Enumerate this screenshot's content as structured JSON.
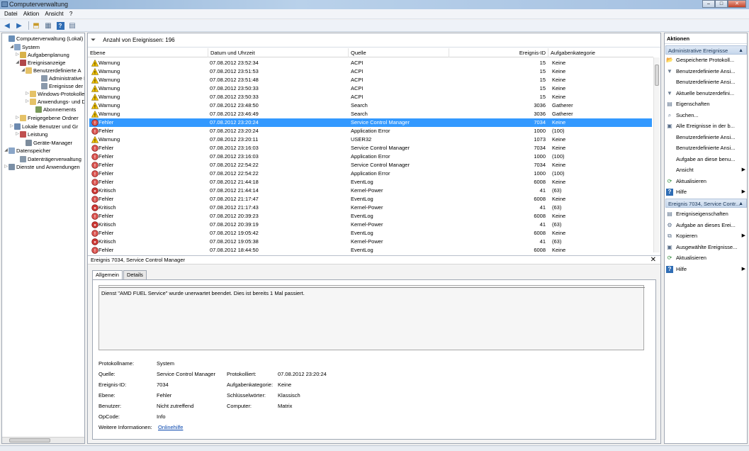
{
  "window": {
    "title": "Computerverwaltung",
    "min": "–",
    "max": "□",
    "close": "✕"
  },
  "menu": [
    "Datei",
    "Aktion",
    "Ansicht",
    "?"
  ],
  "tree": [
    {
      "label": "Computerverwaltung (Lokal)",
      "exp": "",
      "icon": "computer-icon",
      "color": "#6a8fb8"
    },
    {
      "label": "System",
      "exp": "◢",
      "icon": "system-icon",
      "color": "#8aa6c8"
    },
    {
      "label": "Aufgabenplanung",
      "exp": "▷",
      "icon": "clock-icon",
      "color": "#d8b24a"
    },
    {
      "label": "Ereignisanzeige",
      "exp": "◢",
      "icon": "event-viewer-icon",
      "color": "#b0484a"
    },
    {
      "label": "Benutzerdefinierte A",
      "exp": "◢",
      "icon": "folder-icon",
      "color": "#e5c268"
    },
    {
      "label": "Administrative E",
      "exp": "",
      "icon": "filter-icon",
      "color": "#8a99ab"
    },
    {
      "label": "Ereignisse der Zu",
      "exp": "",
      "icon": "filter-icon",
      "color": "#8a99ab"
    },
    {
      "label": "Windows-Protokolle",
      "exp": "▷",
      "icon": "folder-icon",
      "color": "#e5c268"
    },
    {
      "label": "Anwendungs- und D",
      "exp": "▷",
      "icon": "folder-icon",
      "color": "#e5c268"
    },
    {
      "label": "Abonnements",
      "exp": "",
      "icon": "subscription-icon",
      "color": "#7a9a5a"
    },
    {
      "label": "Freigegebene Ordner",
      "exp": "▷",
      "icon": "shared-folder-icon",
      "color": "#e5c268"
    },
    {
      "label": "Lokale Benutzer und Gr",
      "exp": "▷",
      "icon": "users-icon",
      "color": "#6d8ab0"
    },
    {
      "label": "Leistung",
      "exp": "▷",
      "icon": "performance-icon",
      "color": "#c05050"
    },
    {
      "label": "Geräte-Manager",
      "exp": "",
      "icon": "device-manager-icon",
      "color": "#7c8c9c"
    },
    {
      "label": "Datenspeicher",
      "exp": "◢",
      "icon": "storage-icon",
      "color": "#8aa6c8"
    },
    {
      "label": "Datenträgerverwaltung",
      "exp": "",
      "icon": "disk-icon",
      "color": "#8899aa"
    },
    {
      "label": "Dienste und Anwendungen",
      "exp": "▷",
      "icon": "services-icon",
      "color": "#7b8fa6"
    }
  ],
  "filterbar": {
    "label": "Anzahl von Ereignissen: 196"
  },
  "columns": {
    "level": "Ebene",
    "date": "Datum und Uhrzeit",
    "source": "Quelle",
    "id": "Ereignis-ID",
    "category": "Aufgabenkategorie"
  },
  "rows": [
    {
      "level": "Warnung",
      "type": "warning",
      "date": "07.08.2012 23:52:34",
      "source": "ACPI",
      "id": "15",
      "category": "Keine"
    },
    {
      "level": "Warnung",
      "type": "warning",
      "date": "07.08.2012 23:51:53",
      "source": "ACPI",
      "id": "15",
      "category": "Keine"
    },
    {
      "level": "Warnung",
      "type": "warning",
      "date": "07.08.2012 23:51:48",
      "source": "ACPI",
      "id": "15",
      "category": "Keine"
    },
    {
      "level": "Warnung",
      "type": "warning",
      "date": "07.08.2012 23:50:33",
      "source": "ACPI",
      "id": "15",
      "category": "Keine"
    },
    {
      "level": "Warnung",
      "type": "warning",
      "date": "07.08.2012 23:50:33",
      "source": "ACPI",
      "id": "15",
      "category": "Keine"
    },
    {
      "level": "Warnung",
      "type": "warning",
      "date": "07.08.2012 23:48:50",
      "source": "Search",
      "id": "3036",
      "category": "Gatherer"
    },
    {
      "level": "Warnung",
      "type": "warning",
      "date": "07.08.2012 23:46:49",
      "source": "Search",
      "id": "3036",
      "category": "Gatherer"
    },
    {
      "level": "Fehler",
      "type": "error",
      "date": "07.08.2012 23:20:24",
      "source": "Service Control Manager",
      "id": "7034",
      "category": "Keine",
      "selected": true
    },
    {
      "level": "Fehler",
      "type": "error",
      "date": "07.08.2012 23:20:24",
      "source": "Application Error",
      "id": "1000",
      "category": "(100)"
    },
    {
      "level": "Warnung",
      "type": "warning",
      "date": "07.08.2012 23:20:11",
      "source": "USER32",
      "id": "1073",
      "category": "Keine"
    },
    {
      "level": "Fehler",
      "type": "error",
      "date": "07.08.2012 23:16:03",
      "source": "Service Control Manager",
      "id": "7034",
      "category": "Keine"
    },
    {
      "level": "Fehler",
      "type": "error",
      "date": "07.08.2012 23:16:03",
      "source": "Application Error",
      "id": "1000",
      "category": "(100)"
    },
    {
      "level": "Fehler",
      "type": "error",
      "date": "07.08.2012 22:54:22",
      "source": "Service Control Manager",
      "id": "7034",
      "category": "Keine"
    },
    {
      "level": "Fehler",
      "type": "error",
      "date": "07.08.2012 22:54:22",
      "source": "Application Error",
      "id": "1000",
      "category": "(100)"
    },
    {
      "level": "Fehler",
      "type": "error",
      "date": "07.08.2012 21:44:18",
      "source": "EventLog",
      "id": "6008",
      "category": "Keine"
    },
    {
      "level": "Kritisch",
      "type": "critical",
      "date": "07.08.2012 21:44:14",
      "source": "Kernel-Power",
      "id": "41",
      "category": "(63)"
    },
    {
      "level": "Fehler",
      "type": "error",
      "date": "07.08.2012 21:17:47",
      "source": "EventLog",
      "id": "6008",
      "category": "Keine"
    },
    {
      "level": "Kritisch",
      "type": "critical",
      "date": "07.08.2012 21:17:43",
      "source": "Kernel-Power",
      "id": "41",
      "category": "(63)"
    },
    {
      "level": "Fehler",
      "type": "error",
      "date": "07.08.2012 20:39:23",
      "source": "EventLog",
      "id": "6008",
      "category": "Keine"
    },
    {
      "level": "Kritisch",
      "type": "critical",
      "date": "07.08.2012 20:39:19",
      "source": "Kernel-Power",
      "id": "41",
      "category": "(63)"
    },
    {
      "level": "Fehler",
      "type": "error",
      "date": "07.08.2012 19:05:42",
      "source": "EventLog",
      "id": "6008",
      "category": "Keine"
    },
    {
      "level": "Kritisch",
      "type": "critical",
      "date": "07.08.2012 19:05:38",
      "source": "Kernel-Power",
      "id": "41",
      "category": "(63)"
    },
    {
      "level": "Fehler",
      "type": "error",
      "date": "07.08.2012 18:44:50",
      "source": "EventLog",
      "id": "6008",
      "category": "Keine"
    }
  ],
  "detail": {
    "header": "Ereignis 7034, Service Control Manager",
    "tabs": [
      "Allgemein",
      "Details"
    ],
    "message": "Dienst \"AMD FUEL Service\" wurde unerwartet beendet. Dies ist bereits 1 Mal passiert.",
    "labels": {
      "logname": "Protokollname:",
      "source": "Quelle:",
      "eventid": "Ereignis-ID:",
      "level": "Ebene:",
      "user": "Benutzer:",
      "opcode": "OpCode:",
      "moreinfo": "Weitere Informationen:",
      "logged": "Protokolliert:",
      "taskcat": "Aufgabenkategorie:",
      "keywords": "Schlüsselwörter:",
      "computer": "Computer:"
    },
    "values": {
      "logname": "System",
      "source": "Service Control Manager",
      "eventid": "7034",
      "level": "Fehler",
      "user": "Nicht zutreffend",
      "opcode": "Info",
      "moreinfo": "Onlinehilfe",
      "logged": "07.08.2012 23:20:24",
      "taskcat": "Keine",
      "keywords": "Klassisch",
      "computer": "Matrix"
    }
  },
  "actions": {
    "title": "Aktionen",
    "section1": "Administrative Ereignisse",
    "items1": [
      {
        "label": "Gespeicherte Protokoll...",
        "icon": "open-log-icon",
        "glyph": "📂",
        "sub": ""
      },
      {
        "label": "Benutzerdefinierte Ansi...",
        "icon": "filter-icon",
        "glyph": "▼",
        "sub": ""
      },
      {
        "label": "Benutzerdefinierte Ansi...",
        "icon": "blank-icon",
        "glyph": "",
        "sub": ""
      },
      {
        "label": "Aktuelle benutzerdefini...",
        "icon": "filter-icon",
        "glyph": "▼",
        "sub": ""
      },
      {
        "label": "Eigenschaften",
        "icon": "properties-icon",
        "glyph": "▤",
        "sub": ""
      },
      {
        "label": "Suchen...",
        "icon": "find-icon",
        "glyph": "⌕",
        "sub": ""
      },
      {
        "label": "Alle Ereignisse in der b...",
        "icon": "save-icon",
        "glyph": "▣",
        "sub": ""
      },
      {
        "label": "Benutzerdefinierte Ansi...",
        "icon": "blank-icon",
        "glyph": "",
        "sub": ""
      },
      {
        "label": "Benutzerdefinierte Ansi...",
        "icon": "blank-icon",
        "glyph": "",
        "sub": ""
      },
      {
        "label": "Aufgabe an diese benu...",
        "icon": "blank-icon",
        "glyph": "",
        "sub": ""
      },
      {
        "label": "Ansicht",
        "icon": "blank-icon",
        "glyph": "",
        "sub": "▶"
      },
      {
        "label": "Aktualisieren",
        "icon": "refresh-icon",
        "glyph": "⟳",
        "sub": ""
      },
      {
        "label": "Hilfe",
        "icon": "help-icon",
        "glyph": "?",
        "sub": "▶"
      }
    ],
    "section2": "Ereignis 7034, Service Contr...",
    "items2": [
      {
        "label": "Ereigniseigenschaften",
        "icon": "properties-icon",
        "glyph": "▤",
        "sub": ""
      },
      {
        "label": "Aufgabe an dieses Erei...",
        "icon": "task-icon",
        "glyph": "⚙",
        "sub": ""
      },
      {
        "label": "Kopieren",
        "icon": "copy-icon",
        "glyph": "⧉",
        "sub": "▶"
      },
      {
        "label": "Ausgewählte Ereignisse...",
        "icon": "save-icon",
        "glyph": "▣",
        "sub": ""
      },
      {
        "label": "Aktualisieren",
        "icon": "refresh-icon",
        "glyph": "⟳",
        "sub": ""
      },
      {
        "label": "Hilfe",
        "icon": "help-icon",
        "glyph": "?",
        "sub": "▶"
      }
    ]
  },
  "colors": {
    "selection": "#3399ff",
    "warning": "#f2c200",
    "error": "#d9534f",
    "critical": "#c9302c",
    "link": "#0645ad"
  }
}
